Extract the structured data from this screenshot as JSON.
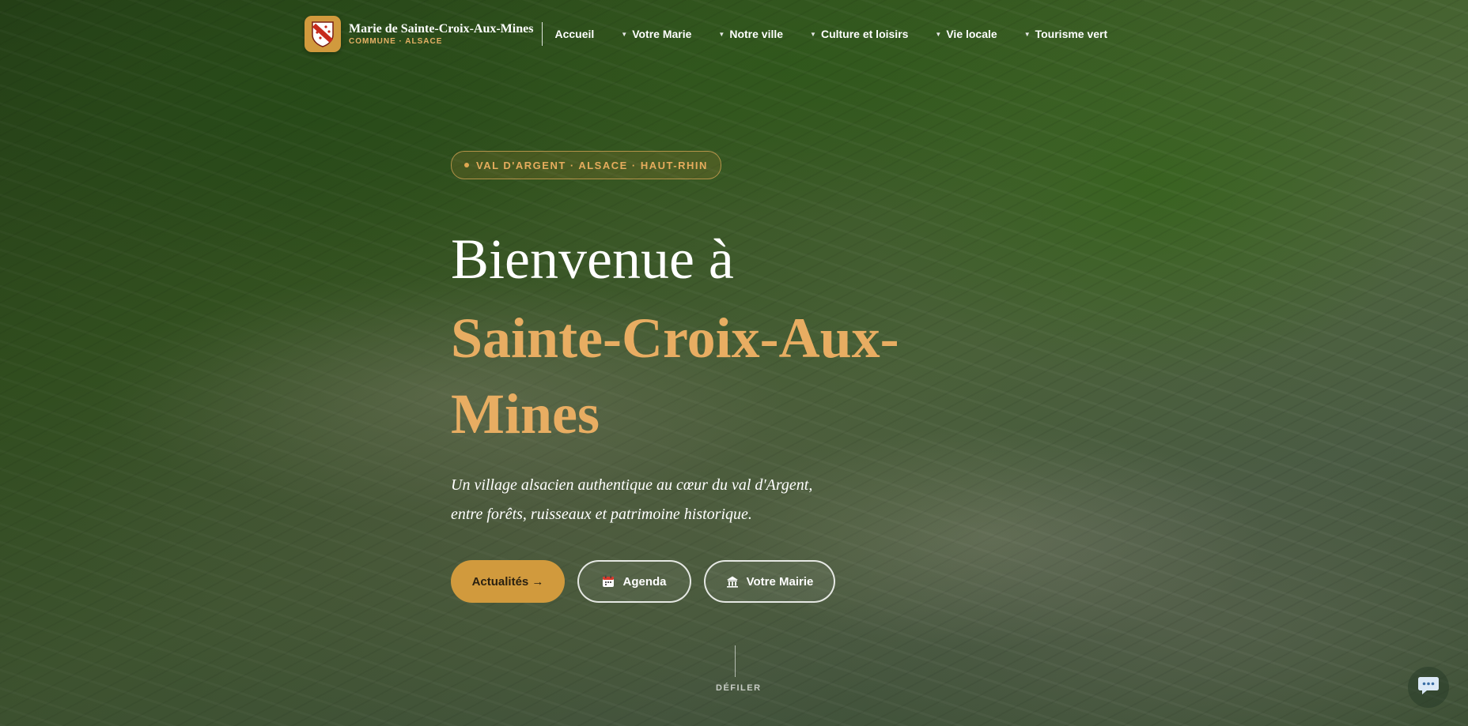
{
  "brand": {
    "name": "Marie de Sainte-Croix-Aux-Mines",
    "subtitle": "COMMUNE · ALSACE"
  },
  "nav": {
    "items": [
      {
        "label": "Accueil",
        "has_dropdown": false
      },
      {
        "label": "Votre Marie",
        "has_dropdown": true
      },
      {
        "label": "Notre ville",
        "has_dropdown": true
      },
      {
        "label": "Culture et loisirs",
        "has_dropdown": true
      },
      {
        "label": "Vie locale",
        "has_dropdown": true
      },
      {
        "label": "Tourisme vert",
        "has_dropdown": true
      }
    ],
    "caret_icon": "caret-down-icon"
  },
  "hero": {
    "badge": "VAL D'ARGENT · ALSACE · HAUT-RHIN",
    "title_line1": "Bienvenue à",
    "title_line2": "Sainte-Croix-Aux-Mines",
    "subtitle": "Un village alsacien authentique au cœur du val d'Argent, entre forêts, ruisseaux et patrimoine historique."
  },
  "buttons": {
    "news": "Actualités →",
    "agenda": "Agenda",
    "agenda_icon": "calendar-icon",
    "mairie": "Votre Mairie",
    "mairie_icon": "building-icon"
  },
  "scroll": {
    "label": "DÉFILER"
  },
  "chat": {
    "icon": "chat-bubble-icon"
  },
  "colors": {
    "accent": "#d19a3d",
    "title_accent": "#e8ad62",
    "white": "#ffffff"
  }
}
